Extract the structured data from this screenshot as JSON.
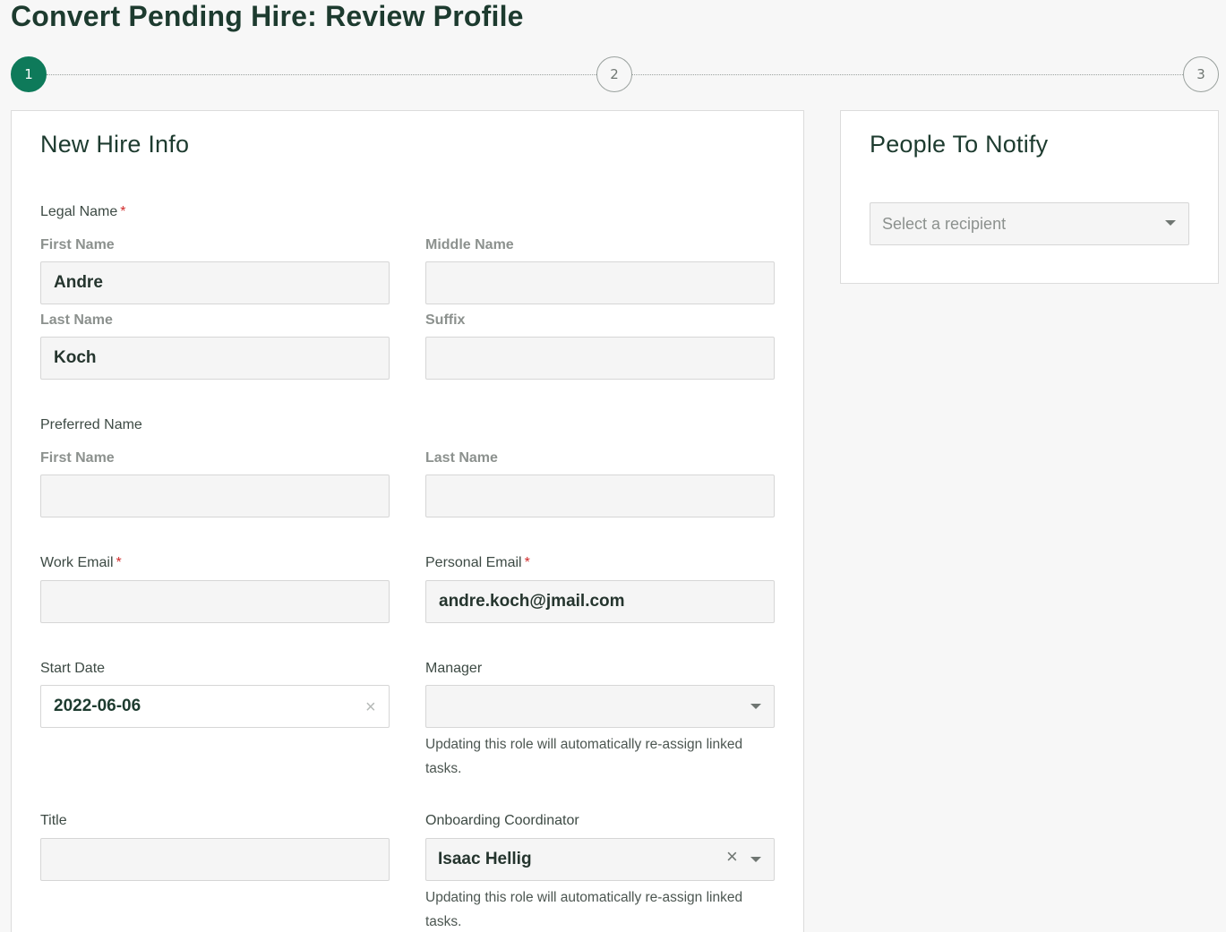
{
  "title": {
    "prefix": "Convert Pending Hire: ",
    "bold": "Review Profile"
  },
  "stepper": {
    "steps": [
      "1",
      "2",
      "3"
    ],
    "active_step": 1
  },
  "new_hire": {
    "card_title": "New Hire Info",
    "legal_name": {
      "label": "Legal Name",
      "required_mark": "*",
      "first_name_label": "First Name",
      "first_name_value": "Andre",
      "middle_name_label": "Middle Name",
      "middle_name_value": "",
      "last_name_label": "Last Name",
      "last_name_value": "Koch",
      "suffix_label": "Suffix",
      "suffix_value": ""
    },
    "preferred_name": {
      "label": "Preferred Name",
      "first_name_label": "First Name",
      "first_name_value": "",
      "last_name_label": "Last Name",
      "last_name_value": ""
    },
    "work_email": {
      "label": "Work Email",
      "required_mark": "*",
      "value": ""
    },
    "personal_email": {
      "label": "Personal Email",
      "required_mark": "*",
      "value": "andre.koch@jmail.com"
    },
    "start_date": {
      "label": "Start Date",
      "value": "2022-06-06",
      "clear_glyph": "×"
    },
    "manager": {
      "label": "Manager",
      "value": "",
      "hint": "Updating this role will automatically re-assign linked tasks."
    },
    "title_field": {
      "label": "Title",
      "value": ""
    },
    "onboarding_coordinator": {
      "label": "Onboarding Coordinator",
      "value": "Isaac Hellig",
      "clear_glyph": "×",
      "hint": "Updating this role will automatically re-assign linked tasks."
    }
  },
  "notify": {
    "card_title": "People To Notify",
    "placeholder": "Select a recipient"
  },
  "colors": {
    "accent": "#0e7a5a",
    "heading": "#1d3b2f",
    "required": "#d02b2b"
  }
}
